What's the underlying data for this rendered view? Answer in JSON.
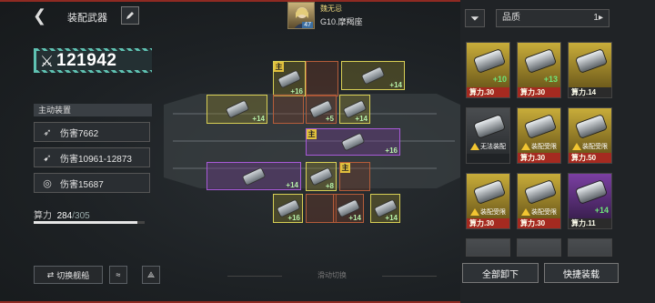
{
  "header": {
    "title": "装配武器",
    "commander_name": "魏无忌",
    "commander_level": "47",
    "ship_name": "G10.摩羯座"
  },
  "power": {
    "value": "121942"
  },
  "active_equipment": {
    "label": "主动装置",
    "stats": [
      {
        "text": "伤害7662",
        "icon": "missile-icon"
      },
      {
        "text": "伤害10961-12873",
        "icon": "rocket-icon"
      },
      {
        "text": "伤害15687",
        "icon": "target-icon"
      }
    ]
  },
  "capacity": {
    "label": "算力",
    "current": "284",
    "max": "/305",
    "fraction": 0.931
  },
  "buttons": {
    "switch_ship": "切换舰船",
    "swipe_hint": "滑动切换",
    "unequip_all": "全部卸下",
    "quick_equip": "快捷装载"
  },
  "filter": {
    "sort_label": "品质"
  },
  "slots": {
    "main_tag": "主",
    "counts": [
      "+16",
      "+14",
      "+14",
      "+5",
      "+14",
      "+16",
      "+14",
      "+8",
      "+16",
      "+14",
      "+14"
    ]
  },
  "inventory": [
    {
      "power": "算力.30",
      "count": "+10",
      "quality": "yl",
      "tag": ""
    },
    {
      "power": "算力.30",
      "count": "+13",
      "quality": "yl",
      "tag": ""
    },
    {
      "power": "算力.14",
      "count": "",
      "quality": "yl",
      "tag": ""
    },
    {
      "power": "",
      "count": "",
      "quality": "gy",
      "tag": "无法装配"
    },
    {
      "power": "算力.30",
      "count": "",
      "quality": "yl",
      "tag": "装配受限"
    },
    {
      "power": "算力.50",
      "count": "",
      "quality": "yl",
      "tag": "装配受限"
    },
    {
      "power": "算力.30",
      "count": "",
      "quality": "yl",
      "tag": "装配受限"
    },
    {
      "power": "算力.30",
      "count": "",
      "quality": "yl",
      "tag": "装配受限"
    },
    {
      "power": "算力.11",
      "count": "+14",
      "quality": "pr",
      "tag": ""
    }
  ],
  "colors": {
    "accent": "#5fc2b2",
    "gold": "#d8cf55",
    "purple": "#a85ad8",
    "red": "#a52a20"
  }
}
